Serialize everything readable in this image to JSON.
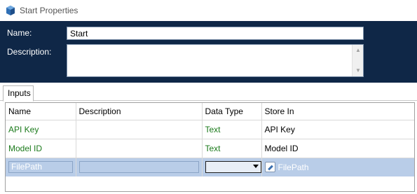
{
  "window": {
    "title": "Start Properties",
    "icon": "flow-start-icon"
  },
  "header": {
    "name_label": "Name:",
    "name_value": "Start",
    "description_label": "Description:",
    "description_value": ""
  },
  "tabs": [
    {
      "label": "Inputs",
      "active": true
    }
  ],
  "grid": {
    "columns": [
      "Name",
      "Description",
      "Data Type",
      "Store In"
    ],
    "rows": [
      {
        "name": "API Key",
        "description": "",
        "data_type": "Text",
        "store_in": "API Key"
      },
      {
        "name": "Model ID",
        "description": "",
        "data_type": "Text",
        "store_in": "Model ID"
      },
      {
        "name": "FilePath",
        "description": "",
        "data_type": "",
        "store_in": "FilePath",
        "selected": true
      }
    ]
  },
  "colors": {
    "header_bg": "#0f2747",
    "green_text": "#1b7a1b",
    "selection": "#b9cde8"
  }
}
